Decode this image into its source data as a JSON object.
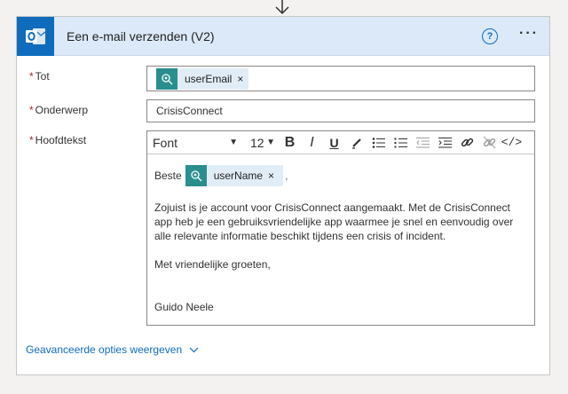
{
  "header": {
    "title": "Een e-mail verzenden (V2)",
    "help_label": "?",
    "more_label": "···"
  },
  "fields": {
    "to": {
      "label": "Tot",
      "token": "userEmail",
      "remove": "×"
    },
    "subject": {
      "label": "Onderwerp",
      "value": "CrisisConnect"
    },
    "body": {
      "label": "Hoofdtekst",
      "toolbar": {
        "font": "Font",
        "size": "12"
      },
      "greeting": "Beste",
      "token": "userName",
      "remove": "×",
      "after_token": ",",
      "paragraph": "Zojuist is je account voor CrisisConnect aangemaakt. Met de CrisisConnect app heb je een gebruiksvriendelijke app waarmee je snel en eenvoudig over alle relevante informatie beschikt tijdens een crisis of incident.",
      "closing": "Met vriendelijke groeten,",
      "signature": "Guido Neele"
    },
    "required_marker": "*"
  },
  "advanced": {
    "label": "Geavanceerde opties weergeven"
  },
  "colors": {
    "accent": "#0f6cbd",
    "token_icon": "#2a8e8e",
    "header_bg": "#dbe9f8",
    "required": "#a4262c"
  }
}
